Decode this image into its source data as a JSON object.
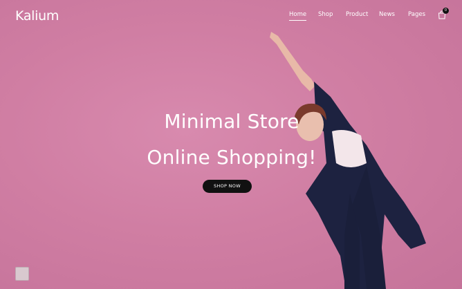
{
  "header": {
    "logo": "Kalium",
    "nav": [
      {
        "label": "Home",
        "active": true
      },
      {
        "label": "Shop",
        "active": false
      },
      {
        "label": "Product",
        "active": false
      },
      {
        "label": "News",
        "active": false
      },
      {
        "label": "Pages",
        "active": false
      }
    ],
    "cart_count": "0",
    "cart_icon": "shopping-bag-icon"
  },
  "hero": {
    "title_line1": "Minimal Store",
    "title_line2": "Online Shopping!",
    "button_label": "SHOP NOW"
  },
  "colors": {
    "background": "#d07ea3",
    "button": "#111111",
    "text": "#ffffff"
  }
}
